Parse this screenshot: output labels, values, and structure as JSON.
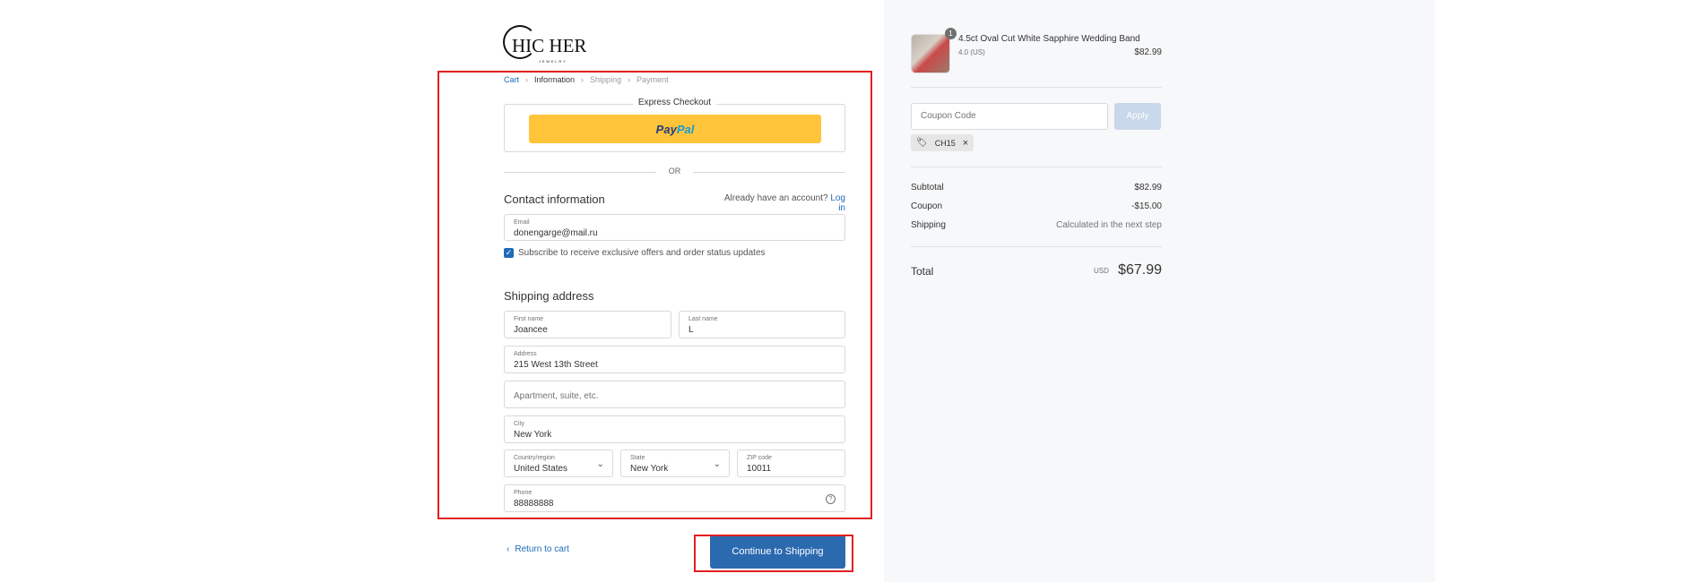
{
  "logo": {
    "text": "HIC HER",
    "subtitle": "JEWELRY"
  },
  "breadcrumb": {
    "cart": "Cart",
    "information": "Information",
    "shipping": "Shipping",
    "payment": "Payment",
    "separator": "›"
  },
  "express": {
    "label": "Express Checkout",
    "paypal_part1": "Pay",
    "paypal_part2": "Pal"
  },
  "or_text": "OR",
  "contact": {
    "title": "Contact information",
    "account_prompt": "Already have an account?",
    "login_link": "Log in",
    "email_label": "Email",
    "email_value": "donengarge@mail.ru",
    "subscribe_label": "Subscribe to receive exclusive offers and order status updates",
    "subscribe_checked": true
  },
  "shipping": {
    "title": "Shipping address",
    "first_name_label": "First name",
    "first_name_value": "Joancee",
    "last_name_label": "Last name",
    "last_name_value": "L",
    "address_label": "Address",
    "address_value": "215 West 13th Street",
    "apartment_placeholder": "Apartment, suite, etc.",
    "city_label": "City",
    "city_value": "New York",
    "country_label": "Country/region",
    "country_value": "United States",
    "state_label": "State",
    "state_value": "New York",
    "zip_label": "ZIP code",
    "zip_value": "10011",
    "phone_label": "Phone",
    "phone_value": "88888888"
  },
  "footer": {
    "return_label": "Return to cart",
    "continue_label": "Continue to Shipping"
  },
  "order": {
    "quantity": "1",
    "product_name": "4.5ct Oval Cut White Sapphire Wedding Band",
    "product_variant": "4.0 (US)",
    "product_price": "$82.99",
    "coupon_placeholder": "Coupon Code",
    "apply_label": "Apply",
    "applied_code": "CH15",
    "subtotal_label": "Subtotal",
    "subtotal_value": "$82.99",
    "coupon_label": "Coupon",
    "coupon_value": "-$15.00",
    "shipping_label": "Shipping",
    "shipping_value": "Calculated in the next step",
    "total_label": "Total",
    "total_currency": "USD",
    "total_value": "$67.99"
  },
  "colors": {
    "accent": "#1f6bb5",
    "button": "#2c6ab0",
    "paypal": "#ffc43a",
    "highlight": "#e02020"
  }
}
